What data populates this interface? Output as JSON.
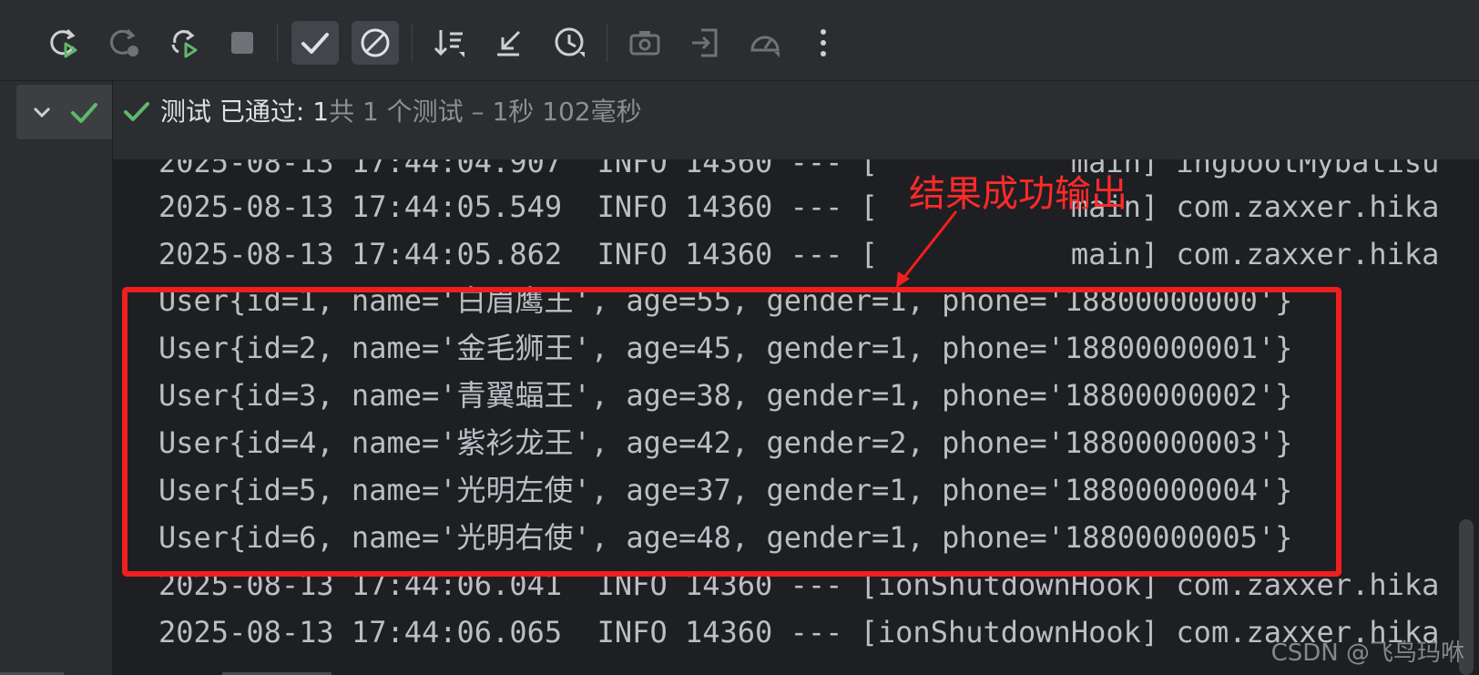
{
  "toolbar": {
    "buttons": [
      {
        "name": "rerun-icon"
      },
      {
        "name": "rerun-failed-icon"
      },
      {
        "name": "toggle-autotest-icon"
      },
      {
        "name": "stop-icon"
      },
      {
        "name": "show-passed-icon"
      },
      {
        "name": "show-ignored-icon"
      },
      {
        "name": "sort-icon"
      },
      {
        "name": "collapse-icon"
      },
      {
        "name": "history-icon"
      },
      {
        "name": "screenshot-icon"
      },
      {
        "name": "export-icon"
      },
      {
        "name": "coverage-icon"
      },
      {
        "name": "more-options-icon"
      }
    ],
    "accent": "#5fb86c"
  },
  "status": {
    "passed_text": "测试 已通过: 1",
    "meta_text": "共 1 个测试 – 1秒 102毫秒"
  },
  "console": {
    "lines": [
      "2025-08-13 17:44:04.907  INFO 14360 --- [           main] ingbootMybatisu",
      "2025-08-13 17:44:05.549  INFO 14360 --- [           main] com.zaxxer.hika",
      "2025-08-13 17:44:05.862  INFO 14360 --- [           main] com.zaxxer.hika",
      "User{id=1, name='白眉鹰王', age=55, gender=1, phone='18800000000'}",
      "User{id=2, name='金毛狮王', age=45, gender=1, phone='18800000001'}",
      "User{id=3, name='青翼蝠王', age=38, gender=1, phone='18800000002'}",
      "User{id=4, name='紫衫龙王', age=42, gender=2, phone='18800000003'}",
      "User{id=5, name='光明左使', age=37, gender=1, phone='18800000004'}",
      "User{id=6, name='光明右使', age=48, gender=1, phone='18800000005'}",
      "2025-08-13 17:44:06.041  INFO 14360 --- [ionShutdownHook] com.zaxxer.hika",
      "2025-08-13 17:44:06.065  INFO 14360 --- [ionShutdownHook] com.zaxxer.hika"
    ]
  },
  "annotation": {
    "label": "结果成功输出",
    "color": "#f01f1f"
  },
  "watermark": "CSDN @飞鸟玛咻"
}
